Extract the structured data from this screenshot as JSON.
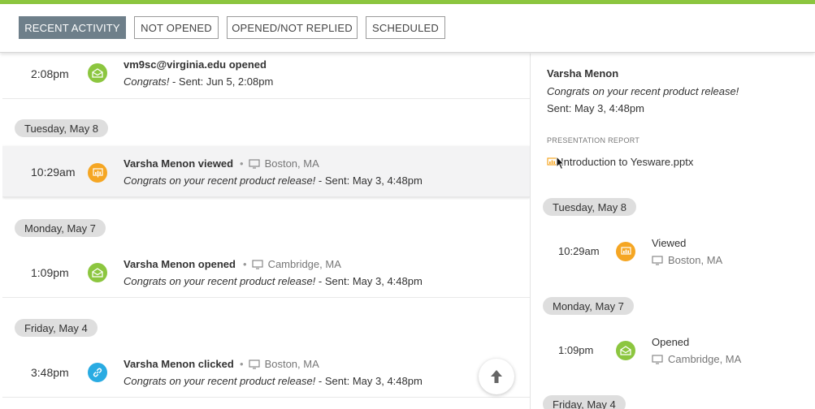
{
  "colors": {
    "accent_bar": "#8cc63f",
    "active_tab": "#6e7f8a",
    "opened": "#8cc63f",
    "viewed": "#f5a623",
    "clicked": "#29abe2"
  },
  "tabs": [
    {
      "label": "RECENT ACTIVITY",
      "active": true
    },
    {
      "label": "NOT OPENED",
      "active": false
    },
    {
      "label": "OPENED/NOT REPLIED",
      "active": false
    },
    {
      "label": "SCHEDULED",
      "active": false
    }
  ],
  "feed": {
    "first": {
      "time": "2:08pm",
      "icon": "envelope-open-icon",
      "title": "vm9sc@virginia.edu opened",
      "subject": "Congrats!",
      "sent": " - Sent: Jun 5, 2:08pm"
    },
    "groups": [
      {
        "date": "Tuesday, May 8",
        "item": {
          "time": "10:29am",
          "icon": "presentation-icon",
          "title": "Varsha Menon viewed",
          "location": "Boston, MA",
          "subject": "Congrats on your recent product release!",
          "sent": " - Sent: May 3, 4:48pm"
        }
      },
      {
        "date": "Monday, May 7",
        "item": {
          "time": "1:09pm",
          "icon": "envelope-open-icon",
          "title": "Varsha Menon opened",
          "location": "Cambridge, MA",
          "subject": "Congrats on your recent product release!",
          "sent": " - Sent: May 3, 4:48pm"
        }
      },
      {
        "date": "Friday, May 4",
        "item": {
          "time": "3:48pm",
          "icon": "link-icon",
          "title": "Varsha Menon clicked",
          "location": "Boston, MA",
          "subject": "Congrats on your recent product release!",
          "sent": " - Sent: May 3, 4:48pm"
        }
      }
    ],
    "scroll_top_icon": "arrow-up-icon"
  },
  "detail": {
    "name": "Varsha Menon",
    "subject": "Congrats on your recent product release!",
    "sent": "Sent: May 3, 4:48pm",
    "section_label": "PRESENTATION REPORT",
    "file_name": "Introduction to Yesware.pptx",
    "timeline": [
      {
        "date": "Tuesday, May 8",
        "time": "10:29am",
        "action": "Viewed",
        "location": "Boston, MA",
        "icon": "presentation-icon"
      },
      {
        "date": "Monday, May 7",
        "time": "1:09pm",
        "action": "Opened",
        "location": "Cambridge, MA",
        "icon": "envelope-open-icon"
      },
      {
        "date": "Friday, May 4"
      }
    ]
  }
}
